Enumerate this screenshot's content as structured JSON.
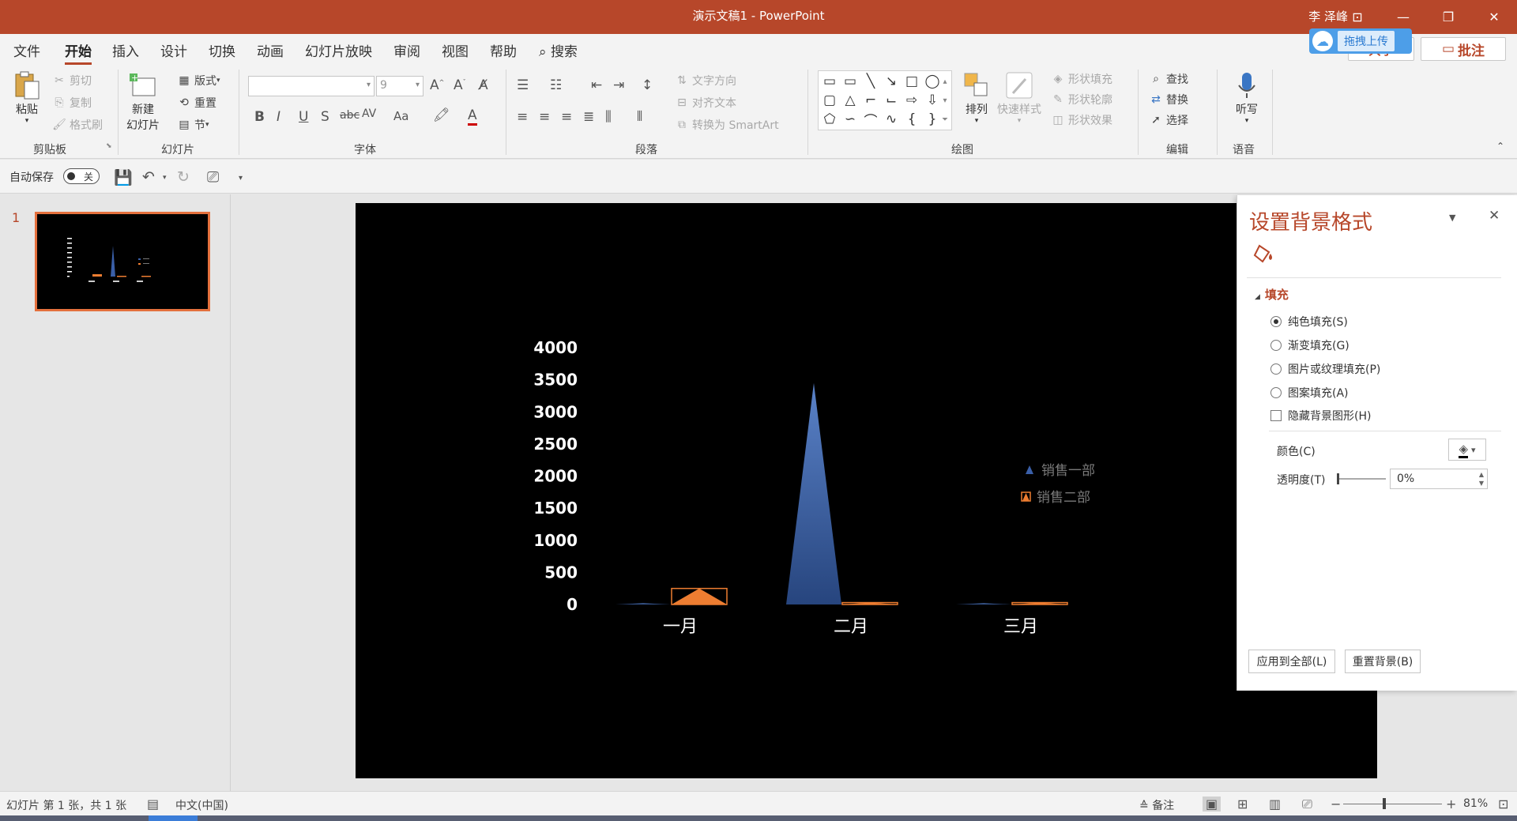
{
  "window": {
    "title": "演示文稿1  -  PowerPoint",
    "user": "李 泽峰"
  },
  "tabs": [
    {
      "label": "文件"
    },
    {
      "label": "开始"
    },
    {
      "label": "插入"
    },
    {
      "label": "设计"
    },
    {
      "label": "切换"
    },
    {
      "label": "动画"
    },
    {
      "label": "幻灯片放映"
    },
    {
      "label": "审阅"
    },
    {
      "label": "视图"
    },
    {
      "label": "帮助"
    },
    {
      "label": "搜索"
    }
  ],
  "header_right": {
    "share": "共享",
    "comment": "批注",
    "upload": "拖拽上传"
  },
  "ribbon": {
    "clipboard": {
      "paste": "粘贴",
      "cut": "剪切",
      "copy": "复制",
      "format_painter": "格式刷",
      "label": "剪贴板"
    },
    "slides": {
      "new_slide_line1": "新建",
      "new_slide_line2": "幻灯片",
      "layout": "版式",
      "reset": "重置",
      "section": "节",
      "label": "幻灯片"
    },
    "font": {
      "name_value": "",
      "size_value": "9",
      "label": "字体",
      "bold": "B",
      "italic": "I",
      "underline": "U",
      "shadow": "S",
      "strike": "abc",
      "spacing": "AV",
      "case": "Aa"
    },
    "paragraph": {
      "text_direction": "文字方向",
      "align_text": "对齐文本",
      "smartart": "转换为 SmartArt",
      "label": "段落"
    },
    "drawing": {
      "arrange": "排列",
      "quick_styles": "快速样式",
      "shape_fill": "形状填充",
      "shape_outline": "形状轮廓",
      "shape_effects": "形状效果",
      "label": "绘图"
    },
    "editing": {
      "find": "查找",
      "replace": "替换",
      "select": "选择",
      "label": "编辑"
    },
    "voice": {
      "dictate": "听写",
      "label": "语音"
    }
  },
  "qat": {
    "autosave_label": "自动保存",
    "autosave_state": "关"
  },
  "thumbnails": {
    "slide_number": "1"
  },
  "chart_data": {
    "type": "bar",
    "categories": [
      "一月",
      "二月",
      "三月"
    ],
    "series": [
      {
        "name": "销售一部",
        "values": [
          20,
          3450,
          20
        ],
        "color": "#3a5fa8",
        "shape": "triangle"
      },
      {
        "name": "销售二部",
        "values": [
          250,
          30,
          30
        ],
        "color": "#ed7d31",
        "shape": "triangle"
      }
    ],
    "ylim": [
      0,
      4000
    ],
    "yticks": [
      0,
      500,
      1000,
      1500,
      2000,
      2500,
      3000,
      3500,
      4000
    ],
    "legend_position": "right",
    "background": "#000000",
    "grid": false
  },
  "format_pane": {
    "title": "设置背景格式",
    "section": "填充",
    "options": [
      {
        "label": "纯色填充(S)",
        "selected": true
      },
      {
        "label": "渐变填充(G)",
        "selected": false
      },
      {
        "label": "图片或纹理填充(P)",
        "selected": false
      },
      {
        "label": "图案填充(A)",
        "selected": false
      }
    ],
    "hide_graphics": "隐藏背景图形(H)",
    "color_label": "颜色(C)",
    "transparency_label": "透明度(T)",
    "transparency_value": "0%",
    "apply_all": "应用到全部(L)",
    "reset_bg": "重置背景(B)"
  },
  "status": {
    "slide_info": "幻灯片 第 1 张，共 1 张",
    "language": "中文(中国)",
    "notes": "备注",
    "zoom": "81%"
  }
}
